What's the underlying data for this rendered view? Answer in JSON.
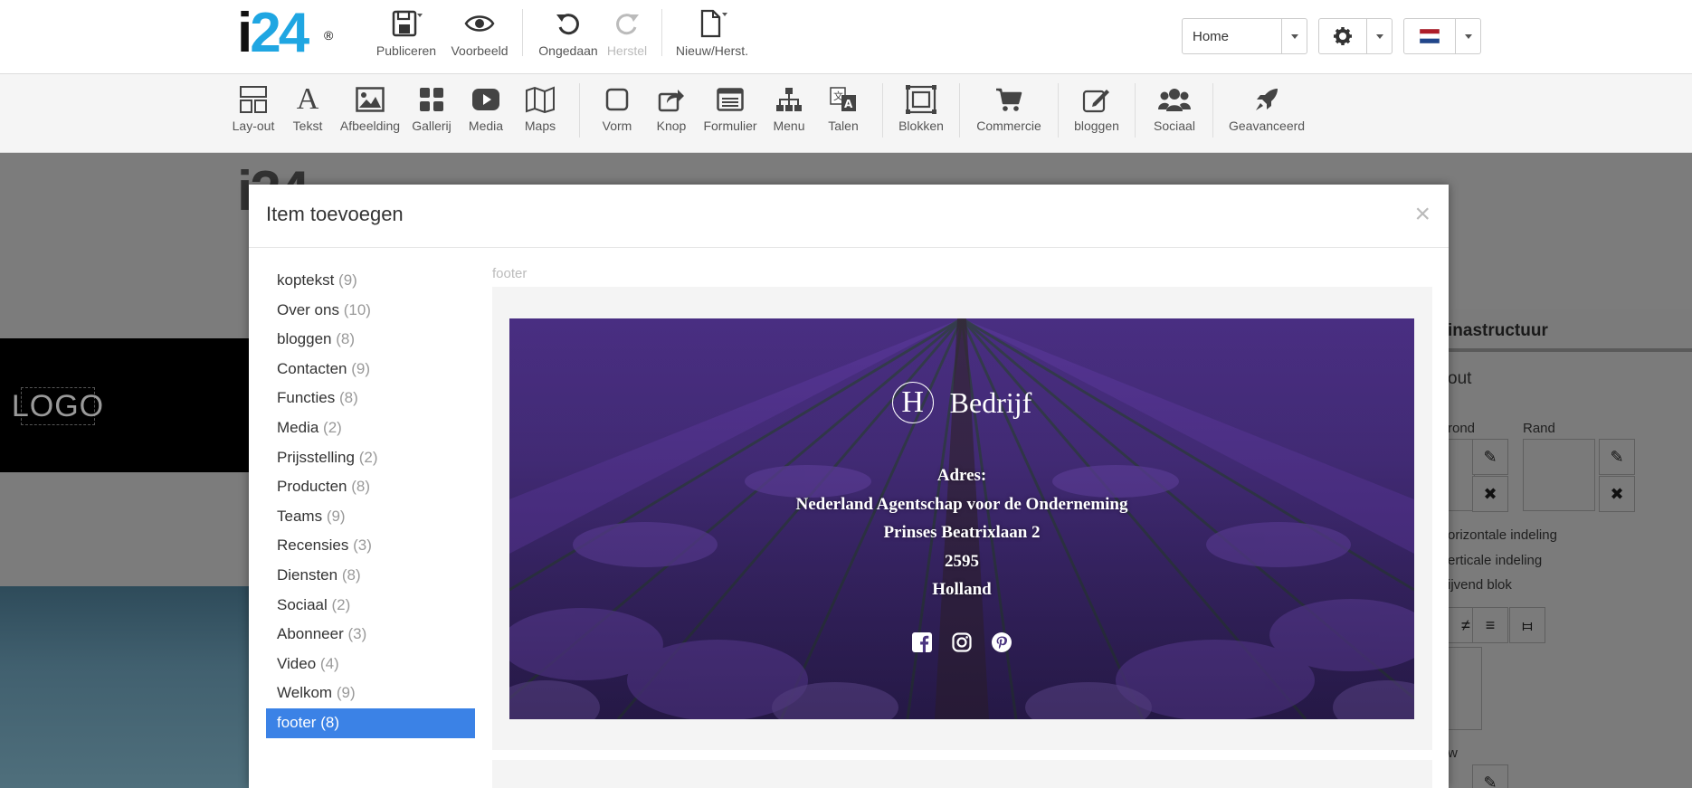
{
  "topbar": {
    "logo_main": "i",
    "logo_num": "24",
    "logo_reg": "®",
    "publish_label": "Publiceren",
    "preview_label": "Voorbeeld",
    "undo_label": "Ongedaan",
    "redo_label": "Herstel",
    "new_label": "Nieuw/Herst.",
    "page_select": "Home"
  },
  "toolbar": {
    "items": [
      {
        "label": "Lay-out",
        "icon": "layout-icon"
      },
      {
        "label": "Tekst",
        "icon": "text-icon"
      },
      {
        "label": "Afbeelding",
        "icon": "image-icon"
      },
      {
        "label": "Gallerij",
        "icon": "gallery-icon"
      },
      {
        "label": "Media",
        "icon": "youtube-icon"
      },
      {
        "label": "Maps",
        "icon": "map-icon"
      },
      {
        "label": "Vorm",
        "icon": "shape-icon"
      },
      {
        "label": "Knop",
        "icon": "share-icon"
      },
      {
        "label": "Formulier",
        "icon": "form-icon"
      },
      {
        "label": "Menu",
        "icon": "sitemap-icon"
      },
      {
        "label": "Talen",
        "icon": "language-icon"
      },
      {
        "label": "Blokken",
        "icon": "blocks-icon"
      },
      {
        "label": "Commercie",
        "icon": "cart-icon"
      },
      {
        "label": "bloggen",
        "icon": "edit-icon"
      },
      {
        "label": "Sociaal",
        "icon": "users-icon"
      },
      {
        "label": "Geavanceerd",
        "icon": "rocket-icon"
      }
    ]
  },
  "background": {
    "logo_placeholder": "LOGO",
    "panel_title": "inastructuur",
    "panel_tab": "out",
    "label_background": "rond",
    "label_border": "Rand",
    "option_horizontal": "orizontale indeling",
    "option_vertical": "erticale indeling",
    "option_floating": "ijvend blok",
    "label_bottom": "w"
  },
  "modal": {
    "title": "Item toevoegen",
    "close": "×",
    "section_label": "footer",
    "categories": [
      {
        "name": "koptekst",
        "count": "(9)"
      },
      {
        "name": "Over ons",
        "count": "(10)"
      },
      {
        "name": "bloggen",
        "count": "(8)"
      },
      {
        "name": "Contacten",
        "count": "(9)"
      },
      {
        "name": "Functies",
        "count": "(8)"
      },
      {
        "name": "Media",
        "count": "(2)"
      },
      {
        "name": "Prijsstelling",
        "count": "(2)"
      },
      {
        "name": "Producten",
        "count": "(8)"
      },
      {
        "name": "Teams",
        "count": "(9)"
      },
      {
        "name": "Recensies",
        "count": "(3)"
      },
      {
        "name": "Diensten",
        "count": "(8)"
      },
      {
        "name": "Sociaal",
        "count": "(2)"
      },
      {
        "name": "Abonneer",
        "count": "(3)"
      },
      {
        "name": "Video",
        "count": "(4)"
      },
      {
        "name": "Welkom",
        "count": "(9)"
      },
      {
        "name": "footer",
        "count": "(8)",
        "active": true
      }
    ],
    "preview": {
      "brand_letter": "H",
      "brand_name": "Bedrijf",
      "address_lines": [
        "Adres:",
        "Nederland Agentschap voor de Onderneming",
        "Prinses Beatrixlaan 2",
        "2595",
        "Holland"
      ],
      "social_icons": [
        "facebook-icon",
        "instagram-icon",
        "pinterest-icon"
      ]
    }
  },
  "colors": {
    "brand_blue": "#1fa6e2",
    "active_blue": "#3b82e6",
    "lavender": "#6a3fb0"
  }
}
